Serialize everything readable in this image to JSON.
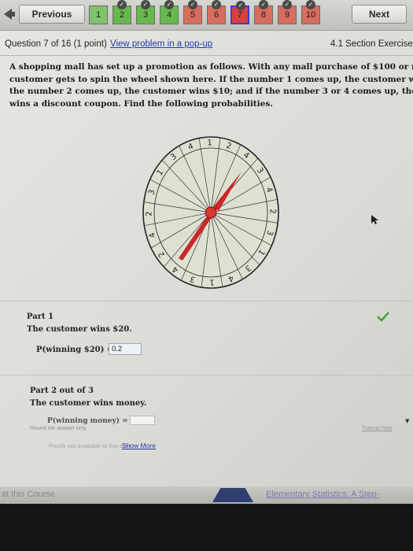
{
  "nav": {
    "previous_label": "Previous",
    "next_label": "Next",
    "questions": [
      {
        "label": "1",
        "bg": "#7fc36a",
        "checked": false
      },
      {
        "label": "2",
        "bg": "#67b94d",
        "checked": true
      },
      {
        "label": "3",
        "bg": "#67b94d",
        "checked": true
      },
      {
        "label": "4",
        "bg": "#67b94d",
        "checked": true
      },
      {
        "label": "5",
        "bg": "#d86d5f",
        "checked": true
      },
      {
        "label": "6",
        "bg": "#d86d5f",
        "checked": true
      },
      {
        "label": "7",
        "bg": "#d94040",
        "checked": true,
        "current": true
      },
      {
        "label": "8",
        "bg": "#d86d5f",
        "checked": true
      },
      {
        "label": "9",
        "bg": "#d86d5f",
        "checked": true
      },
      {
        "label": "10",
        "bg": "#d86d5f",
        "checked": true
      }
    ]
  },
  "header": {
    "question_label": "Question 7 of 16 (1 point)",
    "popup_link": "View problem in a pop-up",
    "section": "4.1 Section Exercise"
  },
  "problem": {
    "lines": [
      "A shopping mall has set up a promotion as follows. With any mall purchase of $100 or more, the",
      "customer gets to spin the wheel shown here. If the number 1 comes up, the customer wins $20. If",
      "the number 2 comes up, the customer wins $10; and if the number 3 or 4 comes up, the customer",
      "wins a discount coupon. Find the following probabilities."
    ]
  },
  "wheel": {
    "labels": [
      "1",
      "2",
      "4",
      "3",
      "4",
      "2",
      "3",
      "1",
      "3",
      "4",
      "1",
      "3",
      "4",
      "2",
      "4",
      "2",
      "3",
      "1",
      "3",
      "4"
    ],
    "colors": {
      "pointer": "#c8282a",
      "hub": "#d83a2e",
      "ring": "#222222",
      "lines": "#333333"
    }
  },
  "part1": {
    "title": "Part 1",
    "text": "The customer wins $20.",
    "expression": "P(winning $20) =",
    "answer": "0.2"
  },
  "part2": {
    "title": "Part 2 out of 3",
    "text": "The customer wins money.",
    "expression": "P(winning money) =",
    "input_value": "",
    "hint": "Round the answer only",
    "tutorial_label": "Tutorial help"
  },
  "footer": {
    "note": "Proofs not available at this time",
    "show_more": "Show More"
  },
  "course_bar": {
    "left_text": "at this Course",
    "right_text": "Elementary Statistics: A Step-"
  }
}
